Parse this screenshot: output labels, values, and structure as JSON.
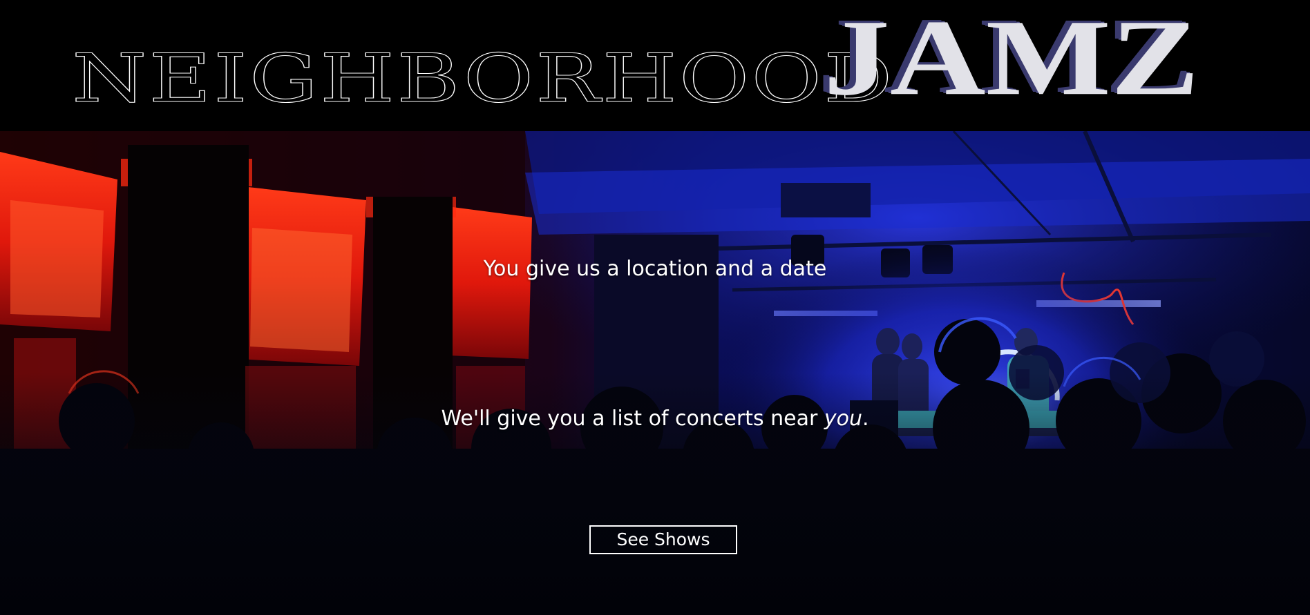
{
  "header": {
    "logo_word_1": "NEIGHBORHOOD",
    "logo_word_2": "JAMZ"
  },
  "hero": {
    "tagline_1": "You give us a location and a date",
    "tagline_2_prefix": "We'll give you a list of concerts near ",
    "tagline_2_emphasis": "you",
    "tagline_2_suffix": ".",
    "cta_label": "See Shows"
  },
  "colors": {
    "header_background": "#000000",
    "text": "#ffffff",
    "stage_light": "#1f3dff",
    "window_glow": "#ff2a10"
  }
}
